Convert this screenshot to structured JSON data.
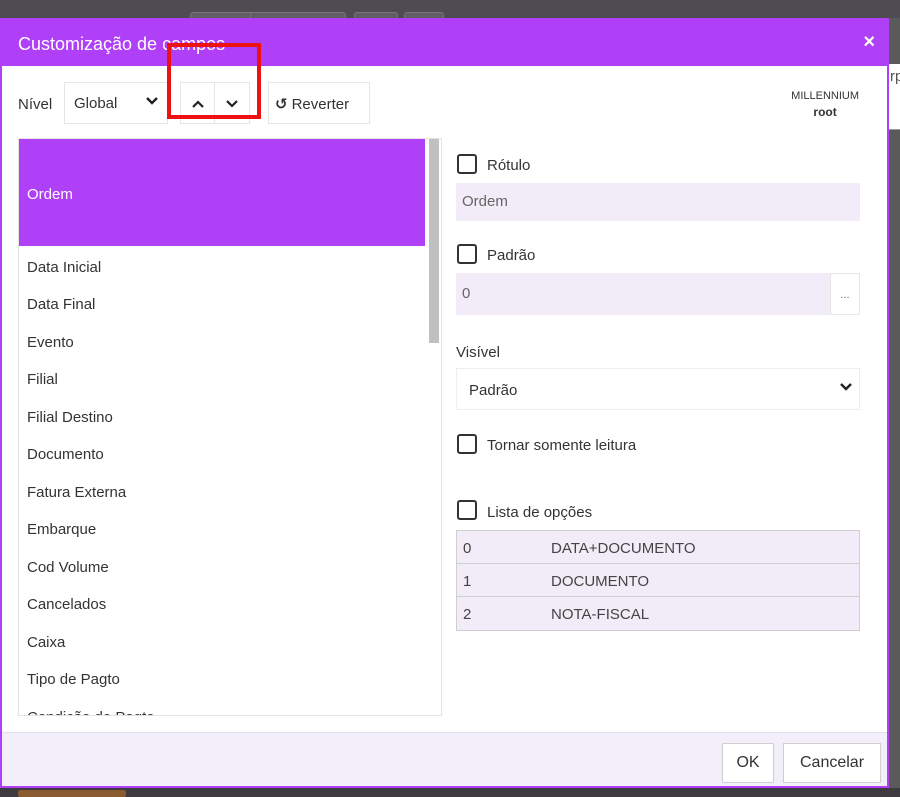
{
  "background": {
    "partial_text": "rp"
  },
  "dialog": {
    "title": "Customização de campos",
    "close_label": "×",
    "accent_color": "#b03ff8"
  },
  "toolbar": {
    "level_label": "Nível",
    "level_value": "Global",
    "up_icon": "chevron-up-icon",
    "down_icon": "chevron-down-icon",
    "revert_label": "Reverter",
    "revert_icon": "undo-icon",
    "system_name": "MILLENNIUM",
    "user_name": "root"
  },
  "fields": {
    "selected": "Ordem",
    "items": [
      "Data Inicial",
      "Data Final",
      "Evento",
      "Filial",
      "Filial Destino",
      "Documento",
      "Fatura Externa",
      "Embarque",
      "Cod Volume",
      "Cancelados",
      "Caixa",
      "Tipo de Pagto",
      "Condição de Pagto"
    ]
  },
  "props": {
    "label_check": "Rótulo",
    "label_value": "Ordem",
    "default_check": "Padrão",
    "default_value": "0",
    "default_more": "...",
    "visible_label": "Visível",
    "visible_value": "Padrão",
    "readonly_check": "Tornar somente leitura",
    "options_check": "Lista de opções",
    "options": [
      {
        "key": "0",
        "value": "DATA+DOCUMENTO"
      },
      {
        "key": "1",
        "value": "DOCUMENTO"
      },
      {
        "key": "2",
        "value": "NOTA-FISCAL"
      }
    ]
  },
  "footer": {
    "ok_label": "OK",
    "cancel_label": "Cancelar"
  }
}
